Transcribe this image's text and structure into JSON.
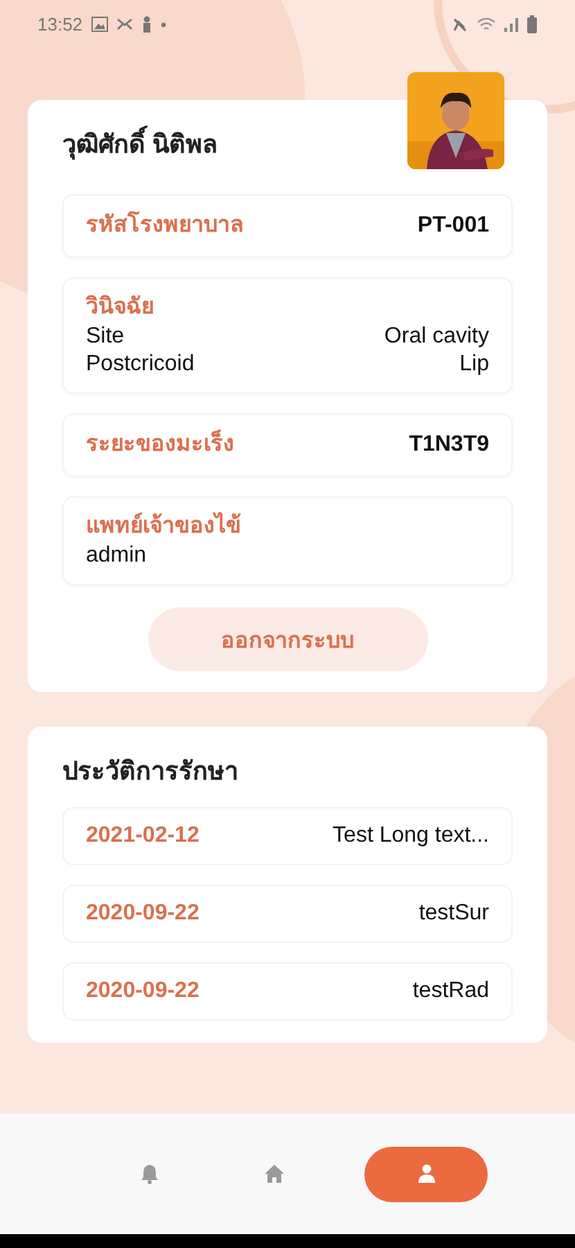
{
  "status_bar": {
    "time": "13:52"
  },
  "profile": {
    "name": "วุฒิศักดิ์ นิติพล",
    "fields": [
      {
        "kind": "pair",
        "label": "รหัสโรงพยาบาล",
        "value": "PT-001"
      },
      {
        "kind": "lines",
        "label": "วินิจฉัย",
        "lines": [
          {
            "left": "Site",
            "right": "Oral cavity"
          },
          {
            "left": "Postcricoid",
            "right": "Lip"
          }
        ]
      },
      {
        "kind": "pair",
        "label": "ระยะของมะเร็ง",
        "value": "T1N3T9"
      },
      {
        "kind": "stacked",
        "label": "แพทย์เจ้าของไข้",
        "value": "admin"
      }
    ],
    "logout_button": "ออกจากระบบ"
  },
  "history": {
    "title": "ประวัติการรักษา",
    "rows": [
      {
        "date": "2021-02-12",
        "name": "Test Long text..."
      },
      {
        "date": "2020-09-22",
        "name": "testSur"
      },
      {
        "date": "2020-09-22",
        "name": "testRad"
      }
    ]
  },
  "nav": [
    {
      "kind": "bell",
      "selected": false
    },
    {
      "kind": "home",
      "selected": false
    },
    {
      "kind": "person",
      "selected": true
    }
  ]
}
